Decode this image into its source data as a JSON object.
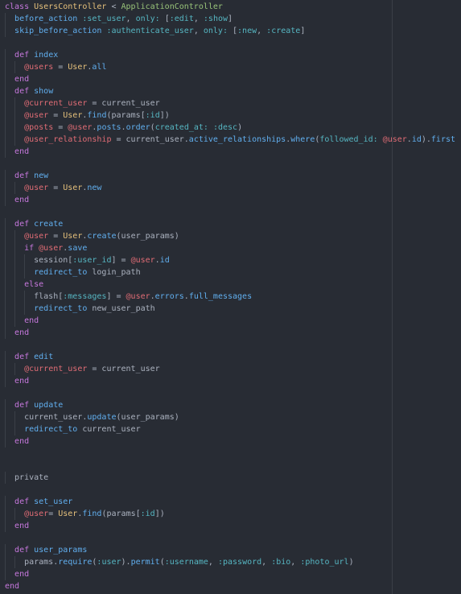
{
  "editor": {
    "theme_colors": {
      "background": "#282c34",
      "keyword": "#c678dd",
      "constant": "#e5c07b",
      "superclass": "#98c379",
      "method": "#61afef",
      "symbol": "#56b6c2",
      "instance_variable": "#e06c75",
      "plain": "#abb2bf"
    },
    "lines": [
      [
        [
          "k",
          "class "
        ],
        [
          "c",
          "UsersController"
        ],
        [
          "p",
          " < "
        ],
        [
          "s",
          "ApplicationController"
        ]
      ],
      [
        [
          "p",
          "  "
        ],
        [
          "f",
          "before_action"
        ],
        [
          "p",
          " "
        ],
        [
          "y",
          ":set_user"
        ],
        [
          "p",
          ", "
        ],
        [
          "y",
          "only:"
        ],
        [
          "p",
          " ["
        ],
        [
          "y",
          ":edit"
        ],
        [
          "p",
          ", "
        ],
        [
          "y",
          ":show"
        ],
        [
          "p",
          "]"
        ]
      ],
      [
        [
          "p",
          "  "
        ],
        [
          "f",
          "skip_before_action"
        ],
        [
          "p",
          " "
        ],
        [
          "y",
          ":authenticate_user"
        ],
        [
          "p",
          ", "
        ],
        [
          "y",
          "only:"
        ],
        [
          "p",
          " ["
        ],
        [
          "y",
          ":new"
        ],
        [
          "p",
          ", "
        ],
        [
          "y",
          ":create"
        ],
        [
          "p",
          "]"
        ]
      ],
      [],
      [
        [
          "p",
          "  "
        ],
        [
          "k",
          "def "
        ],
        [
          "f",
          "index"
        ]
      ],
      [
        [
          "p",
          "    "
        ],
        [
          "v",
          "@users"
        ],
        [
          "p",
          " = "
        ],
        [
          "c",
          "User"
        ],
        [
          "p",
          "."
        ],
        [
          "f",
          "all"
        ]
      ],
      [
        [
          "p",
          "  "
        ],
        [
          "k",
          "end"
        ]
      ],
      [
        [
          "p",
          "  "
        ],
        [
          "k",
          "def "
        ],
        [
          "f",
          "show"
        ]
      ],
      [
        [
          "p",
          "    "
        ],
        [
          "v",
          "@current_user"
        ],
        [
          "p",
          " = current_user"
        ]
      ],
      [
        [
          "p",
          "    "
        ],
        [
          "v",
          "@user"
        ],
        [
          "p",
          " = "
        ],
        [
          "c",
          "User"
        ],
        [
          "p",
          "."
        ],
        [
          "f",
          "find"
        ],
        [
          "p",
          "(params["
        ],
        [
          "y",
          ":id"
        ],
        [
          "p",
          "])"
        ]
      ],
      [
        [
          "p",
          "    "
        ],
        [
          "v",
          "@posts"
        ],
        [
          "p",
          " = "
        ],
        [
          "v",
          "@user"
        ],
        [
          "p",
          "."
        ],
        [
          "f",
          "posts"
        ],
        [
          "p",
          "."
        ],
        [
          "f",
          "order"
        ],
        [
          "p",
          "("
        ],
        [
          "y",
          "created_at:"
        ],
        [
          "p",
          " "
        ],
        [
          "y",
          ":desc"
        ],
        [
          "p",
          ")"
        ]
      ],
      [
        [
          "p",
          "    "
        ],
        [
          "v",
          "@user_relationship"
        ],
        [
          "p",
          " = current_user."
        ],
        [
          "f",
          "active_relationships"
        ],
        [
          "p",
          "."
        ],
        [
          "f",
          "where"
        ],
        [
          "p",
          "("
        ],
        [
          "y",
          "followed_id:"
        ],
        [
          "p",
          " "
        ],
        [
          "v",
          "@user"
        ],
        [
          "p",
          "."
        ],
        [
          "f",
          "id"
        ],
        [
          "p",
          ")."
        ],
        [
          "f",
          "first"
        ]
      ],
      [
        [
          "p",
          "  "
        ],
        [
          "k",
          "end"
        ]
      ],
      [],
      [
        [
          "p",
          "  "
        ],
        [
          "k",
          "def "
        ],
        [
          "f",
          "new"
        ]
      ],
      [
        [
          "p",
          "    "
        ],
        [
          "v",
          "@user"
        ],
        [
          "p",
          " = "
        ],
        [
          "c",
          "User"
        ],
        [
          "p",
          "."
        ],
        [
          "f",
          "new"
        ]
      ],
      [
        [
          "p",
          "  "
        ],
        [
          "k",
          "end"
        ]
      ],
      [],
      [
        [
          "p",
          "  "
        ],
        [
          "k",
          "def "
        ],
        [
          "f",
          "create"
        ]
      ],
      [
        [
          "p",
          "    "
        ],
        [
          "v",
          "@user"
        ],
        [
          "p",
          " = "
        ],
        [
          "c",
          "User"
        ],
        [
          "p",
          "."
        ],
        [
          "f",
          "create"
        ],
        [
          "p",
          "(user_params)"
        ]
      ],
      [
        [
          "p",
          "    "
        ],
        [
          "k",
          "if "
        ],
        [
          "v",
          "@user"
        ],
        [
          "p",
          "."
        ],
        [
          "f",
          "save"
        ]
      ],
      [
        [
          "p",
          "      session["
        ],
        [
          "y",
          ":user_id"
        ],
        [
          "p",
          "] = "
        ],
        [
          "v",
          "@user"
        ],
        [
          "p",
          "."
        ],
        [
          "f",
          "id"
        ]
      ],
      [
        [
          "p",
          "      "
        ],
        [
          "f",
          "redirect_to"
        ],
        [
          "p",
          " login_path"
        ]
      ],
      [
        [
          "p",
          "    "
        ],
        [
          "k",
          "else"
        ]
      ],
      [
        [
          "p",
          "      flash["
        ],
        [
          "y",
          ":messages"
        ],
        [
          "p",
          "] = "
        ],
        [
          "v",
          "@user"
        ],
        [
          "p",
          "."
        ],
        [
          "f",
          "errors"
        ],
        [
          "p",
          "."
        ],
        [
          "f",
          "full_messages"
        ]
      ],
      [
        [
          "p",
          "      "
        ],
        [
          "f",
          "redirect_to"
        ],
        [
          "p",
          " new_user_path"
        ]
      ],
      [
        [
          "p",
          "    "
        ],
        [
          "k",
          "end"
        ]
      ],
      [
        [
          "p",
          "  "
        ],
        [
          "k",
          "end"
        ]
      ],
      [],
      [
        [
          "p",
          "  "
        ],
        [
          "k",
          "def "
        ],
        [
          "f",
          "edit"
        ]
      ],
      [
        [
          "p",
          "    "
        ],
        [
          "v",
          "@current_user"
        ],
        [
          "p",
          " = current_user"
        ]
      ],
      [
        [
          "p",
          "  "
        ],
        [
          "k",
          "end"
        ]
      ],
      [],
      [
        [
          "p",
          "  "
        ],
        [
          "k",
          "def "
        ],
        [
          "f",
          "update"
        ]
      ],
      [
        [
          "p",
          "    current_user."
        ],
        [
          "f",
          "update"
        ],
        [
          "p",
          "(user_params)"
        ]
      ],
      [
        [
          "p",
          "    "
        ],
        [
          "f",
          "redirect_to"
        ],
        [
          "p",
          " current_user"
        ]
      ],
      [
        [
          "p",
          "  "
        ],
        [
          "k",
          "end"
        ]
      ],
      [],
      [],
      [
        [
          "p",
          "  private"
        ]
      ],
      [],
      [
        [
          "p",
          "  "
        ],
        [
          "k",
          "def "
        ],
        [
          "f",
          "set_user"
        ]
      ],
      [
        [
          "p",
          "    "
        ],
        [
          "v",
          "@user"
        ],
        [
          "p",
          "= "
        ],
        [
          "c",
          "User"
        ],
        [
          "p",
          "."
        ],
        [
          "f",
          "find"
        ],
        [
          "p",
          "(params["
        ],
        [
          "y",
          ":id"
        ],
        [
          "p",
          "])"
        ]
      ],
      [
        [
          "p",
          "  "
        ],
        [
          "k",
          "end"
        ]
      ],
      [],
      [
        [
          "p",
          "  "
        ],
        [
          "k",
          "def "
        ],
        [
          "f",
          "user_params"
        ]
      ],
      [
        [
          "p",
          "    params."
        ],
        [
          "f",
          "require"
        ],
        [
          "p",
          "("
        ],
        [
          "y",
          ":user"
        ],
        [
          "p",
          ")."
        ],
        [
          "f",
          "permit"
        ],
        [
          "p",
          "("
        ],
        [
          "y",
          ":username"
        ],
        [
          "p",
          ", "
        ],
        [
          "y",
          ":password"
        ],
        [
          "p",
          ", "
        ],
        [
          "y",
          ":bio"
        ],
        [
          "p",
          ", "
        ],
        [
          "y",
          ":photo_url"
        ],
        [
          "p",
          ")"
        ]
      ],
      [
        [
          "p",
          "  "
        ],
        [
          "k",
          "end"
        ]
      ],
      [
        [
          "k",
          "end"
        ]
      ]
    ]
  }
}
